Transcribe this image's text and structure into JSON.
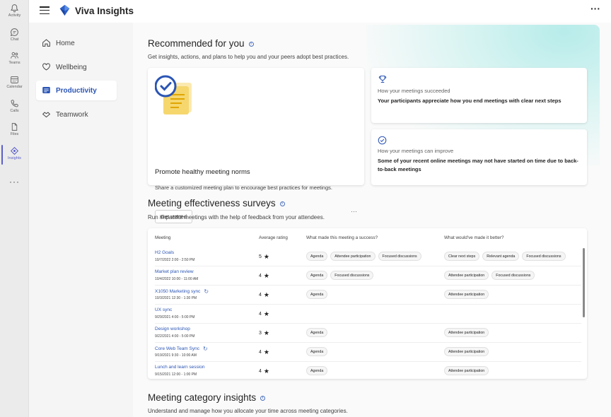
{
  "rail": {
    "items": [
      {
        "label": "Activity",
        "icon": "bell-icon"
      },
      {
        "label": "Chat",
        "icon": "chat-icon"
      },
      {
        "label": "Teams",
        "icon": "teams-icon"
      },
      {
        "label": "Calendar",
        "icon": "calendar-icon"
      },
      {
        "label": "Calls",
        "icon": "phone-icon"
      },
      {
        "label": "Files",
        "icon": "file-icon"
      },
      {
        "label": "Insights",
        "icon": "insights-icon",
        "active": true
      }
    ],
    "more": "···"
  },
  "header": {
    "title": "Viva Insights",
    "more": "···"
  },
  "nav": {
    "items": [
      {
        "label": "Home",
        "icon": "home-icon"
      },
      {
        "label": "Wellbeing",
        "icon": "heart-icon"
      },
      {
        "label": "Productivity",
        "icon": "productivity-icon",
        "active": true
      },
      {
        "label": "Teamwork",
        "icon": "teamwork-icon"
      }
    ]
  },
  "recommended": {
    "title": "Recommended for you",
    "subtitle": "Get insights, actions, and plans to help you and your peers adopt best practices.",
    "card": {
      "title": "Promote healthy meeting norms",
      "text": "Share a customized meeting plan to encourage best practices for meetings.",
      "button": "Get started",
      "more": "···"
    },
    "insights": [
      {
        "label": "How your meetings succeeded",
        "text": "Your participants appreciate how you end meetings with clear next steps",
        "icon": "trophy-icon"
      },
      {
        "label": "How your meetings can improve",
        "text": "Some of your recent online meetings may not have started on time due to back-to-back meetings",
        "icon": "check-circle-icon"
      }
    ]
  },
  "surveys": {
    "title": "Meeting effectiveness surveys",
    "subtitle": "Run impactful meetings with the help of feedback from your attendees.",
    "headers": {
      "meeting": "Meeting",
      "rating": "Average rating",
      "success": "What made this meeting a success?",
      "better": "What would've made it better?"
    },
    "rows": [
      {
        "name": "H2 Goals",
        "date": "10/7/2022   2:00 - 2:50 PM",
        "rating": "5",
        "recurring": false,
        "success": [
          "Agenda",
          "Attendee participation",
          "Focused discussions"
        ],
        "better": [
          "Clear next steps",
          "Relevant agenda",
          "Focused discussions"
        ]
      },
      {
        "name": "Market plan review",
        "date": "10/4/2022   10:00 - 11:00 AM",
        "rating": "4",
        "recurring": false,
        "success": [
          "Agenda",
          "Focused discussions"
        ],
        "better": [
          "Attendee participation",
          "Focused discussions"
        ]
      },
      {
        "name": "X1050 Marketing sync",
        "date": "10/3/2021   12:30 - 1:30 PM",
        "rating": "4",
        "recurring": true,
        "success": [
          "Agenda"
        ],
        "better": [
          "Attendee participation"
        ]
      },
      {
        "name": "UX sync",
        "date": "9/29/2021   4:00 - 5:00 PM",
        "rating": "4",
        "recurring": false,
        "success": [],
        "better": []
      },
      {
        "name": "Design workshop",
        "date": "9/22/2021   4:00 - 5:00 PM",
        "rating": "3",
        "recurring": false,
        "success": [
          "Agenda"
        ],
        "better": [
          "Attendee participation"
        ]
      },
      {
        "name": "Core Web Team Sync",
        "date": "9/19/2021   9:30 - 10:00 AM",
        "rating": "4",
        "recurring": true,
        "success": [
          "Agenda"
        ],
        "better": [
          "Attendee participation"
        ]
      },
      {
        "name": "Lunch and learn session",
        "date": "9/15/2021   12:00 - 1:00 PM",
        "rating": "4",
        "recurring": false,
        "success": [
          "Agenda"
        ],
        "better": [
          "Attendee participation"
        ]
      }
    ]
  },
  "category": {
    "title": "Meeting category insights",
    "subtitle": "Understand and manage how you allocate your time across meeting categories."
  },
  "colors": {
    "accent": "#5b5fc7",
    "link": "#2b55b5",
    "hero": "#b7ecea"
  }
}
